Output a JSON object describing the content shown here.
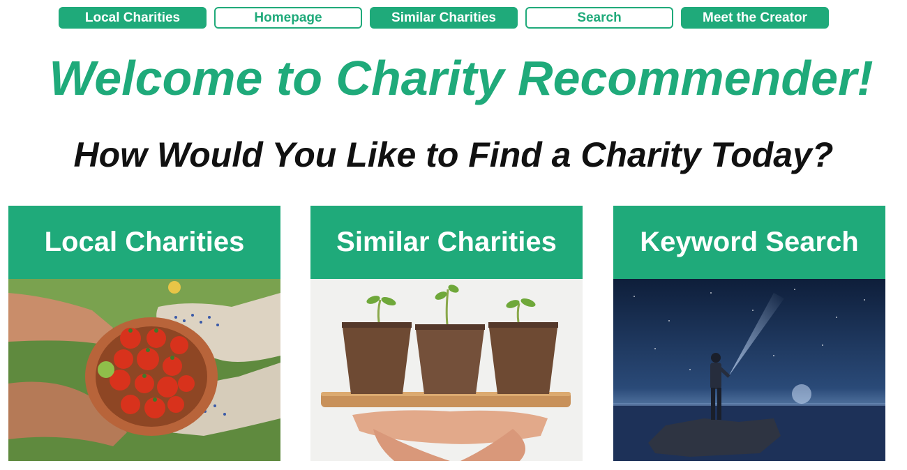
{
  "nav": {
    "items": [
      {
        "label": "Local Charities",
        "style": "filled"
      },
      {
        "label": "Homepage",
        "style": "outline"
      },
      {
        "label": "Similar Charities",
        "style": "filled"
      },
      {
        "label": "Search",
        "style": "outline"
      },
      {
        "label": "Meet the Creator",
        "style": "filled"
      }
    ]
  },
  "hero": {
    "title": "Welcome to Charity Recommender!",
    "subtitle": "How Would You Like to Find a Charity Today?"
  },
  "cards": [
    {
      "title": "Local Charities",
      "image": "tomato-bowl-hands-photo"
    },
    {
      "title": "Similar Charities",
      "image": "seedling-pots-photo"
    },
    {
      "title": "Keyword Search",
      "image": "night-sky-explorer-photo"
    }
  ],
  "colors": {
    "accent": "#1faa7a",
    "heading_dark": "#111111",
    "background": "#ffffff"
  }
}
